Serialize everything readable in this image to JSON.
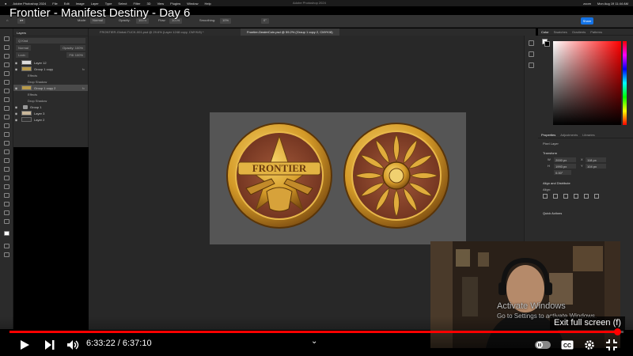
{
  "video": {
    "title": "Frontier - Manifest Destiny - Day 6",
    "time_current": "6:33:22",
    "time_total": "6:37:10",
    "time_display": "6:33:22 / 6:37:10",
    "progress_fraction": 0.99
  },
  "menubar": {
    "apple": "",
    "items": [
      "Adobe Photoshop 2024",
      "File",
      "Edit",
      "Image",
      "Layer",
      "Type",
      "Select",
      "Filter",
      "3D",
      "View",
      "Plugins",
      "Window",
      "Help"
    ],
    "app_title": "Adobe Photoshop 2024",
    "right": [
      "zoom",
      "Mon Aug 19 11:44 AM"
    ]
  },
  "options_bar": {
    "mode_label": "Mode:",
    "mode_value": "Normal",
    "opacity_label": "Opacity:",
    "opacity_value": "100%",
    "flow_label": "Flow:",
    "flow_value": "100%",
    "smoothing_label": "Smoothing:",
    "smoothing_value": "10%",
    "angle_value": "0°",
    "share_label": "Share"
  },
  "layers_panel": {
    "title": "Layers",
    "filter_label": "Q Kind",
    "blend_mode": "Normal",
    "opacity": "Opacity: 100%",
    "fill": "Fill: 100%",
    "lock_label": "Lock:",
    "rows": [
      {
        "name": "Layer 12",
        "thumb": "white",
        "type": "layer",
        "fx": ""
      },
      {
        "name": "Group 1 copy",
        "thumb": "coin",
        "type": "layer",
        "fx": "fx"
      },
      {
        "name": "Effects",
        "type": "sub"
      },
      {
        "name": "Drop Shadow",
        "type": "sub"
      },
      {
        "name": "Group 1 copy 2",
        "thumb": "coin",
        "type": "layer",
        "fx": "fx",
        "selected": true
      },
      {
        "name": "Effects",
        "type": "sub"
      },
      {
        "name": "Drop Shadow",
        "type": "sub"
      },
      {
        "name": "Group 1",
        "type": "folder",
        "fx": ""
      },
      {
        "name": "Layer 3",
        "thumb": "beige",
        "type": "layer",
        "fx": ""
      },
      {
        "name": "Layer 2",
        "thumb": "dark",
        "type": "layer",
        "fx": ""
      }
    ]
  },
  "doc_tabs": [
    {
      "label": "FRONTIER-Global-TUCK-001.psd @ 29.6% (Layer 1248 copy, CMYK/8) *",
      "active": false
    },
    {
      "label": "Frontier-DealerCoin.psd @ 59.2% (Group 1 copy 2, CMYK/8)",
      "active": true
    }
  ],
  "coins": {
    "left_text": "FRONTIER",
    "gold": "#d9a62e",
    "gold_dark": "#8a5a12",
    "copper": "#8c4a32"
  },
  "color_panel": {
    "tabs": [
      "Color",
      "Swatches",
      "Gradients",
      "Patterns"
    ],
    "active_tab": "Color"
  },
  "properties_panel": {
    "tabs": [
      "Properties",
      "Adjustments",
      "Libraries"
    ],
    "active_tab": "Properties",
    "kind": "Pixel Layer",
    "transform_label": "Transform",
    "w_label": "W",
    "w_value": "2000 px",
    "h_label": "H",
    "h_value": "1993 px",
    "x_label": "X",
    "x_value": "118 px",
    "y_label": "Y",
    "y_value": "104 px",
    "angle_value": "0.00°",
    "align_label": "Align and Distribute",
    "align_sub": "Align:",
    "quick_actions": "Quick Actions"
  },
  "overlay": {
    "activate_title": "Activate Windows",
    "activate_sub": "Go to Settings to activate Windows.",
    "exit_fullscreen": "Exit full screen (f)"
  }
}
